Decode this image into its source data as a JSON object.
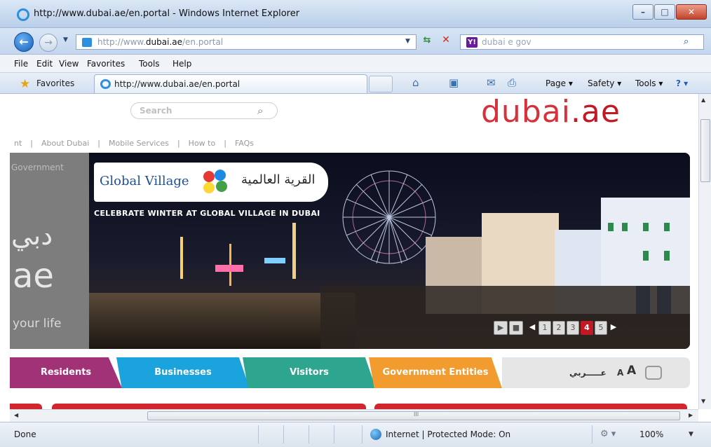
{
  "window": {
    "title": "http://www.dubai.ae/en.portal - Windows Internet Explorer",
    "minimize_glyph": "–",
    "maximize_glyph": "□",
    "close_glyph": "✕"
  },
  "nav": {
    "back_glyph": "←",
    "forward_glyph": "→",
    "dropdown_glyph": "▼",
    "address_prefix": "http://www.",
    "address_domain": "dubai.ae",
    "address_suffix": "/en.portal",
    "refresh_glyph": "⇆",
    "stop_glyph": "✕",
    "search_engine_badge": "Y!",
    "search_value": "dubai e gov",
    "search_go_glyph": "⌕"
  },
  "menu": {
    "items": [
      "File",
      "Edit",
      "View",
      "Favorites",
      "Tools",
      "Help"
    ]
  },
  "favorites_bar": {
    "favorites_label": "Favorites",
    "tab_label": "http://www.dubai.ae/en.portal",
    "commands": {
      "page": "Page ▾",
      "safety": "Safety ▾",
      "tools": "Tools ▾",
      "help": "? ▾"
    }
  },
  "site": {
    "search_label": "Search",
    "search_glyph": "⌕",
    "logo_word": "dubai",
    "logo_tld": ".ae",
    "nav_links": [
      "nt",
      "|",
      "About Dubai",
      "|",
      "Mobile Services",
      "|",
      "How to",
      "|",
      "FAQs"
    ],
    "hero": {
      "sidebar_label": "Government",
      "arabic_wordmark": "دبي",
      "ae_wordmark": "ae",
      "tagline": "your life",
      "promo_title": "Global Village",
      "promo_arabic": "القرية العالمية",
      "promo_caption": "CELEBRATE WINTER AT GLOBAL VILLAGE IN DUBAI",
      "slider": {
        "play_glyph": "▶",
        "stop_glyph": "■",
        "prev_glyph": "◀",
        "next_glyph": "▶",
        "pages": [
          "1",
          "2",
          "3",
          "4",
          "5"
        ],
        "active_page": "4"
      }
    },
    "tabs": {
      "residents": "Residents",
      "businesses": "Businesses",
      "visitors": "Visitors",
      "government": "Government Entities",
      "arabic_link": "عـــــربي",
      "font_small": "A",
      "font_large": "A"
    }
  },
  "scroll": {
    "up_glyph": "▲",
    "down_glyph": "▼",
    "left_glyph": "◀",
    "right_glyph": "▶",
    "grip_glyph": "III"
  },
  "status": {
    "text": "Done",
    "zone": "Internet | Protected Mode: On",
    "zoom": "100%",
    "zoom_dropdown": "▼"
  },
  "colors": {
    "residents": "#a23277",
    "businesses": "#1aa3dc",
    "visitors": "#2ea58e",
    "government": "#f29b2e",
    "brand_red": "#d7323c"
  }
}
